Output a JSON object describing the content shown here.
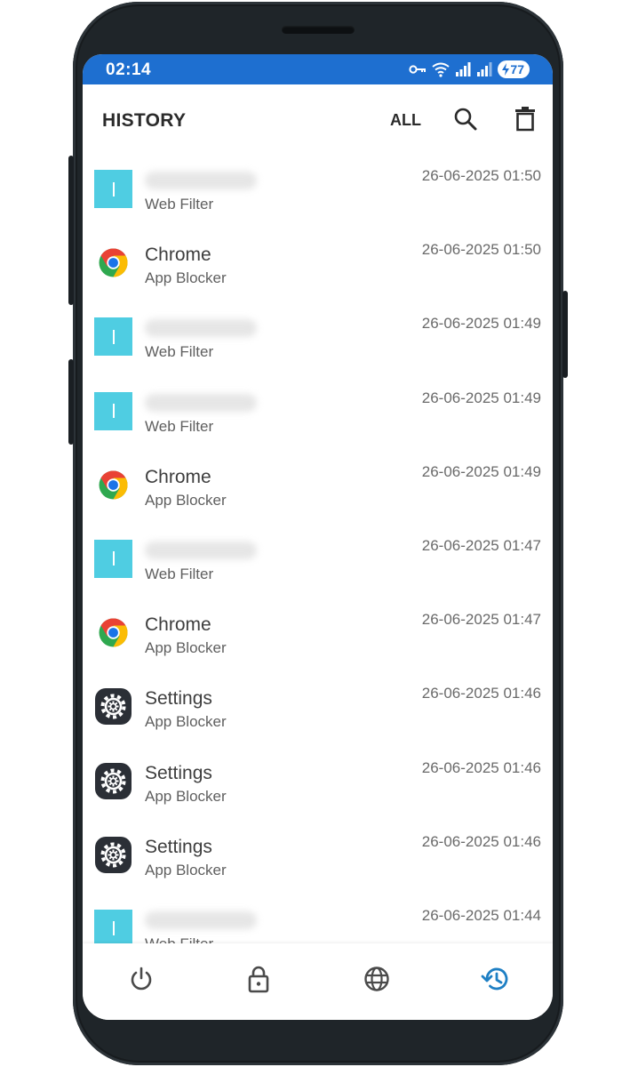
{
  "status_bar": {
    "time": "02:14",
    "battery_level": "77",
    "icons": [
      "vpn-key-icon",
      "wifi-icon",
      "signal-icon",
      "signal-icon",
      "battery-charging-icon"
    ]
  },
  "app_bar": {
    "title": "HISTORY",
    "filter_label": "ALL",
    "actions": [
      "search-icon",
      "delete-icon"
    ]
  },
  "history": [
    {
      "kind": "web",
      "title": "",
      "subtitle": "Web Filter",
      "time": "26-06-2025 01:50"
    },
    {
      "kind": "chrome",
      "title": "Chrome",
      "subtitle": "App Blocker",
      "time": "26-06-2025 01:50"
    },
    {
      "kind": "web",
      "title": "",
      "subtitle": "Web Filter",
      "time": "26-06-2025 01:49"
    },
    {
      "kind": "web",
      "title": "",
      "subtitle": "Web Filter",
      "time": "26-06-2025 01:49"
    },
    {
      "kind": "chrome",
      "title": "Chrome",
      "subtitle": "App Blocker",
      "time": "26-06-2025 01:49"
    },
    {
      "kind": "web",
      "title": "",
      "subtitle": "Web Filter",
      "time": "26-06-2025 01:47"
    },
    {
      "kind": "chrome",
      "title": "Chrome",
      "subtitle": "App Blocker",
      "time": "26-06-2025 01:47"
    },
    {
      "kind": "settings",
      "title": "Settings",
      "subtitle": "App Blocker",
      "time": "26-06-2025 01:46"
    },
    {
      "kind": "settings",
      "title": "Settings",
      "subtitle": "App Blocker",
      "time": "26-06-2025 01:46"
    },
    {
      "kind": "settings",
      "title": "Settings",
      "subtitle": "App Blocker",
      "time": "26-06-2025 01:46"
    },
    {
      "kind": "web",
      "title": "",
      "subtitle": "Web Filter",
      "time": "26-06-2025 01:44"
    }
  ],
  "bottom_nav": [
    {
      "icon": "power-icon",
      "active": false
    },
    {
      "icon": "lock-icon",
      "active": false
    },
    {
      "icon": "globe-icon",
      "active": false
    },
    {
      "icon": "history-icon",
      "active": true
    }
  ],
  "colors": {
    "status_bar": "#1e6fd0",
    "web_filter_tile": "#4fcde2",
    "nav_active": "#1e7fc4",
    "nav_inactive": "#4a4a4a",
    "phone_frame": "#1f2529"
  }
}
